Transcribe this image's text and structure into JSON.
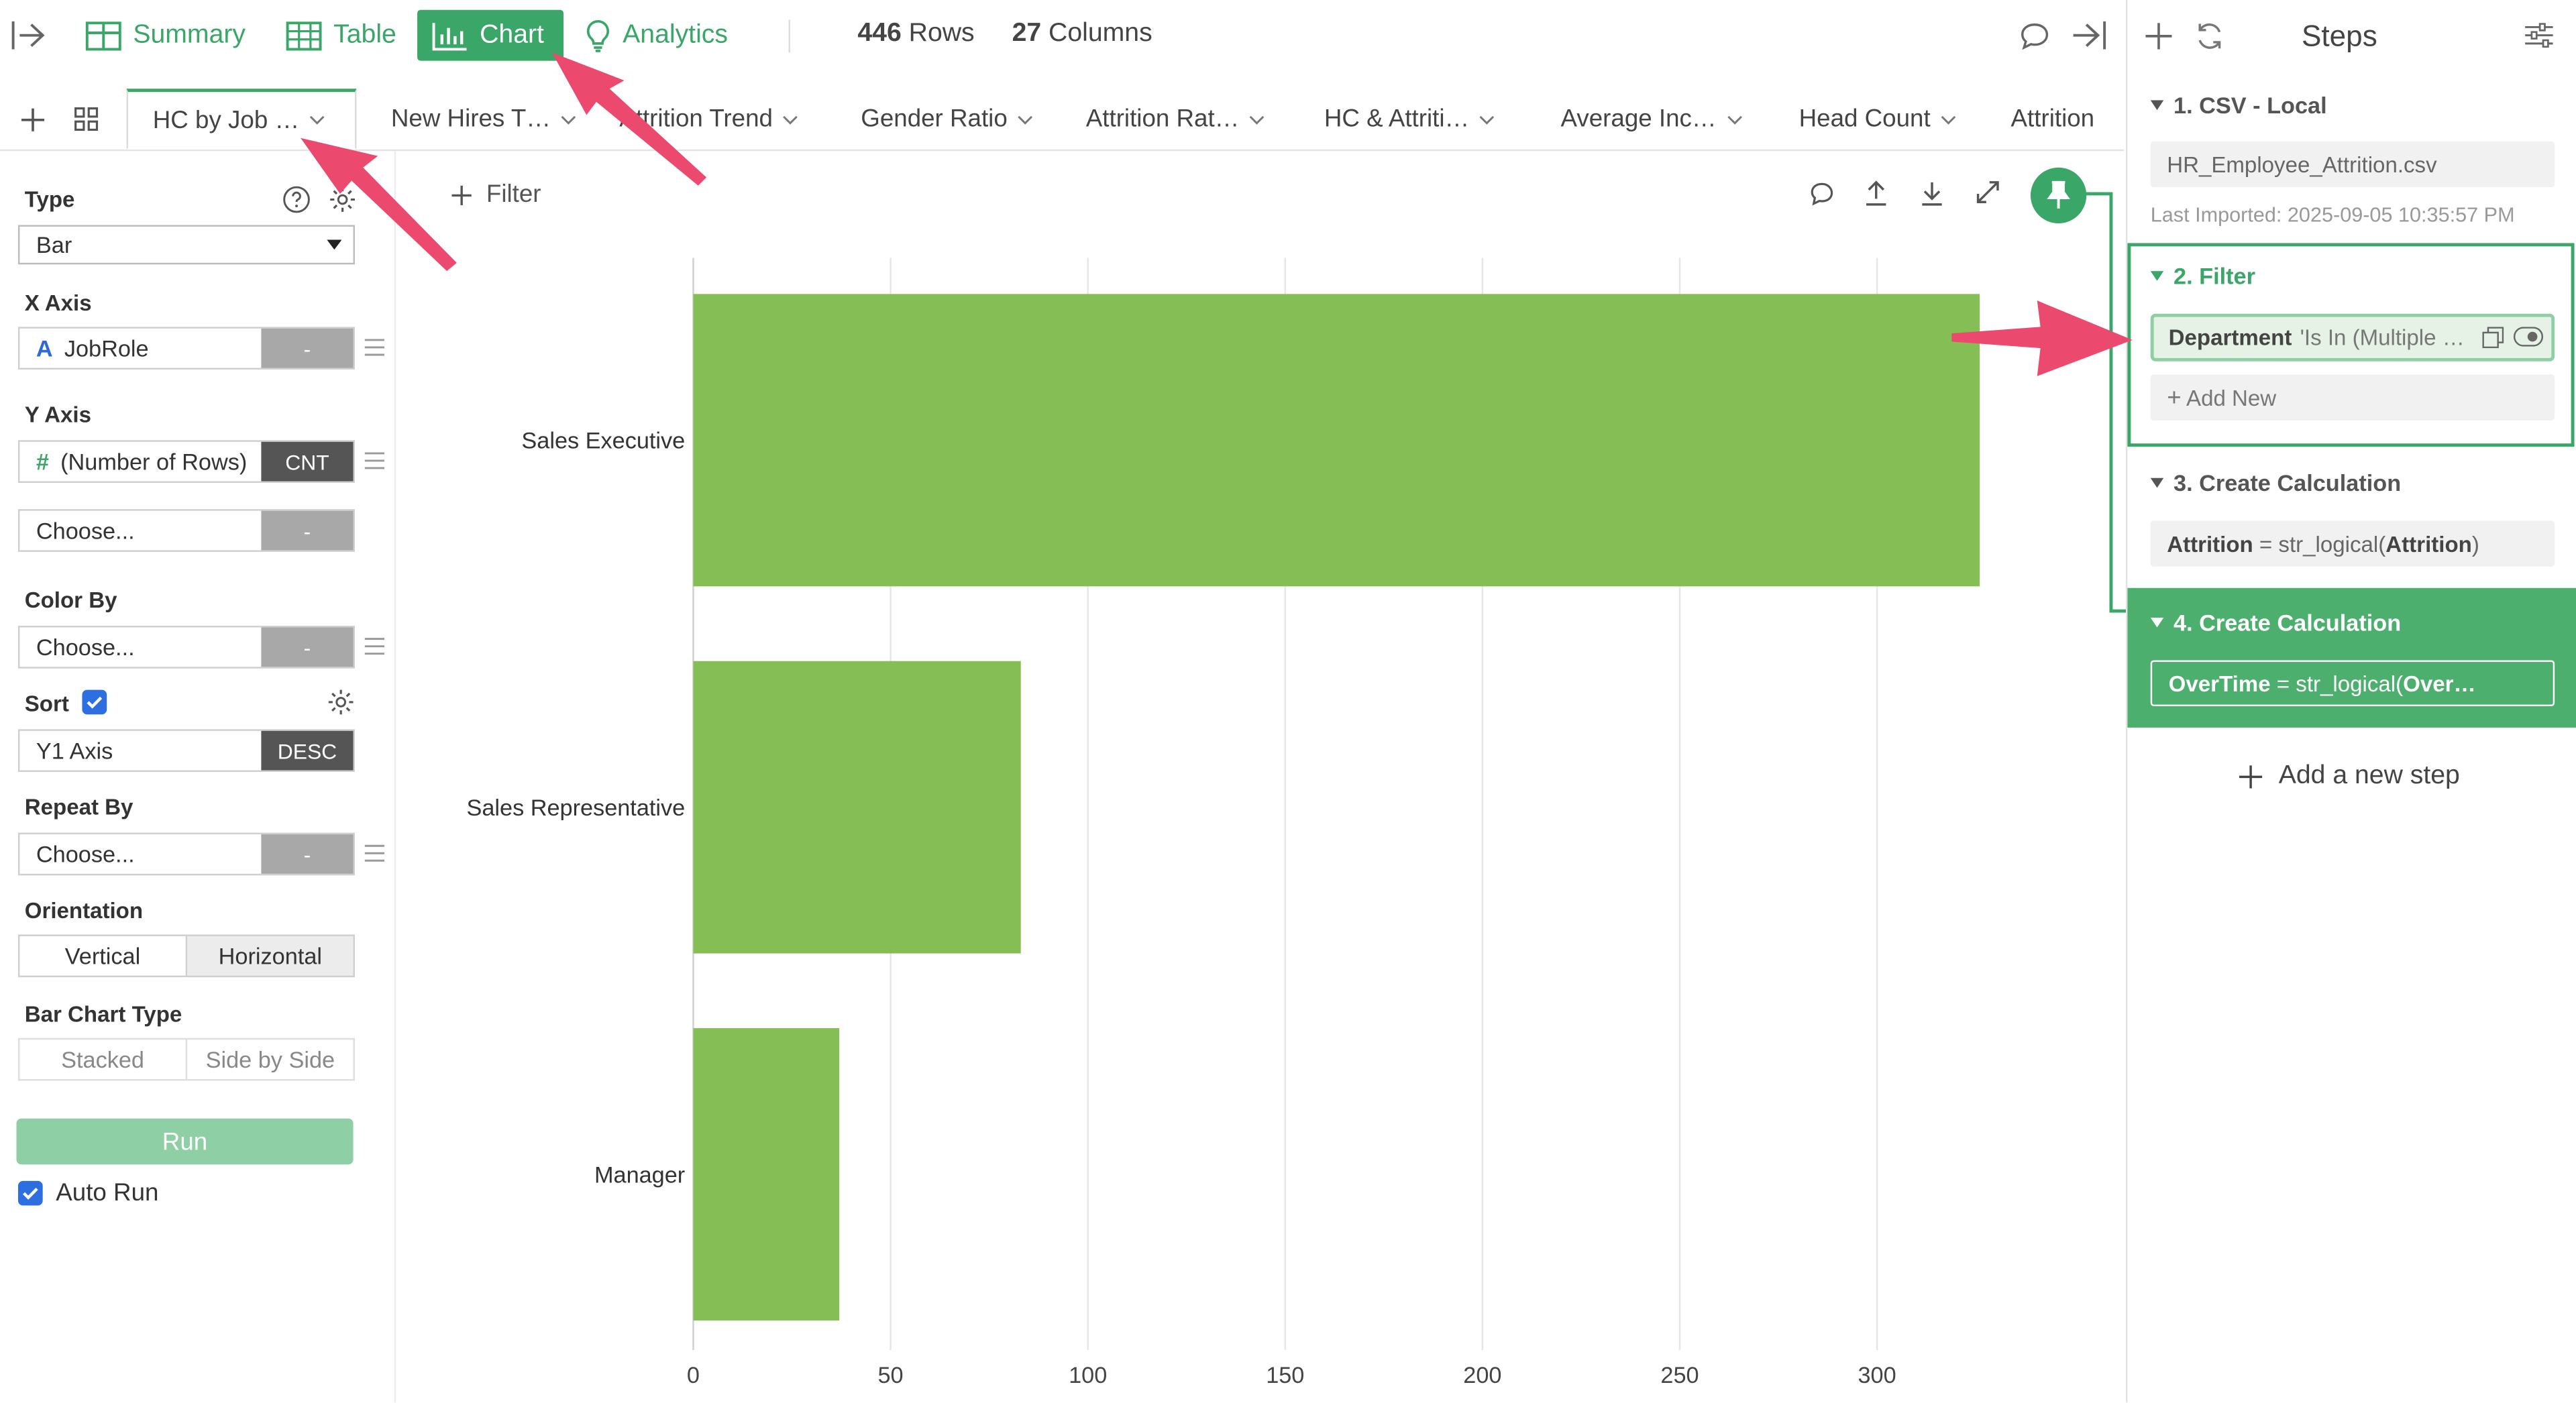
{
  "toolbar": {
    "nav": [
      {
        "label": "Summary",
        "icon": "summary-grid-icon"
      },
      {
        "label": "Table",
        "icon": "table-icon"
      },
      {
        "label": "Chart",
        "icon": "bar-chart-icon"
      },
      {
        "label": "Analytics",
        "icon": "lightbulb-icon"
      }
    ],
    "rows_count": "446",
    "rows_label": "Rows",
    "cols_count": "27",
    "cols_label": "Columns"
  },
  "tabs": [
    "HC by Job …",
    "New Hires T…",
    "Attrition Trend",
    "Gender Ratio",
    "Attrition Rat…",
    "HC & Attriti…",
    "Average Inc…",
    "Head Count",
    "Attrition"
  ],
  "config": {
    "type_label": "Type",
    "type_value": "Bar",
    "x_axis_label": "X Axis",
    "x_axis_value": "JobRole",
    "x_axis_agg": "-",
    "y_axis_label": "Y Axis",
    "y_axis_value": "(Number of Rows)",
    "y_axis_agg": "CNT",
    "y2_value": "Choose...",
    "y2_agg": "-",
    "color_by_label": "Color By",
    "color_by_value": "Choose...",
    "color_by_agg": "-",
    "sort_label": "Sort",
    "sort_value": "Y1 Axis",
    "sort_dir": "DESC",
    "repeat_by_label": "Repeat By",
    "repeat_by_value": "Choose...",
    "repeat_by_agg": "-",
    "orientation_label": "Orientation",
    "orientation_options": [
      "Vertical",
      "Horizontal"
    ],
    "bar_type_label": "Bar Chart Type",
    "bar_type_options": [
      "Stacked",
      "Side by Side"
    ],
    "run_label": "Run",
    "auto_run_label": "Auto Run",
    "filter_label": "Filter"
  },
  "chart_data": {
    "type": "bar",
    "orientation": "horizontal",
    "categories": [
      "Sales Executive",
      "Sales Representative",
      "Manager"
    ],
    "values": [
      326,
      83,
      37
    ],
    "xlim": [
      0,
      326
    ],
    "ticks": [
      0,
      50,
      100,
      150,
      200,
      250,
      300
    ],
    "bar_color": "#85be55",
    "grid": true
  },
  "steps": {
    "title": "Steps",
    "items": [
      {
        "number_title": "1. CSV - Local",
        "file": "HR_Employee_Attrition.csv",
        "note": "Last Imported: 2025-09-05 10:35:57 PM"
      },
      {
        "number_title": "2. Filter",
        "field": "Department",
        "condition": "'Is In (Multiple …",
        "add_new": "Add New"
      },
      {
        "number_title": "3. Create Calculation",
        "field": "Attrition",
        "expr_pre": " = str_logical(",
        "expr_field": "Attrition",
        "expr_post": ")"
      },
      {
        "number_title": "4. Create Calculation",
        "field": "OverTime",
        "expr_pre": " = str_logical(",
        "expr_field": "Over…",
        "expr_post": ""
      }
    ],
    "add_step": "Add a new step"
  },
  "colors": {
    "accent": "#3aa667",
    "bar": "#85be55",
    "annotation": "#eb4a6e"
  }
}
